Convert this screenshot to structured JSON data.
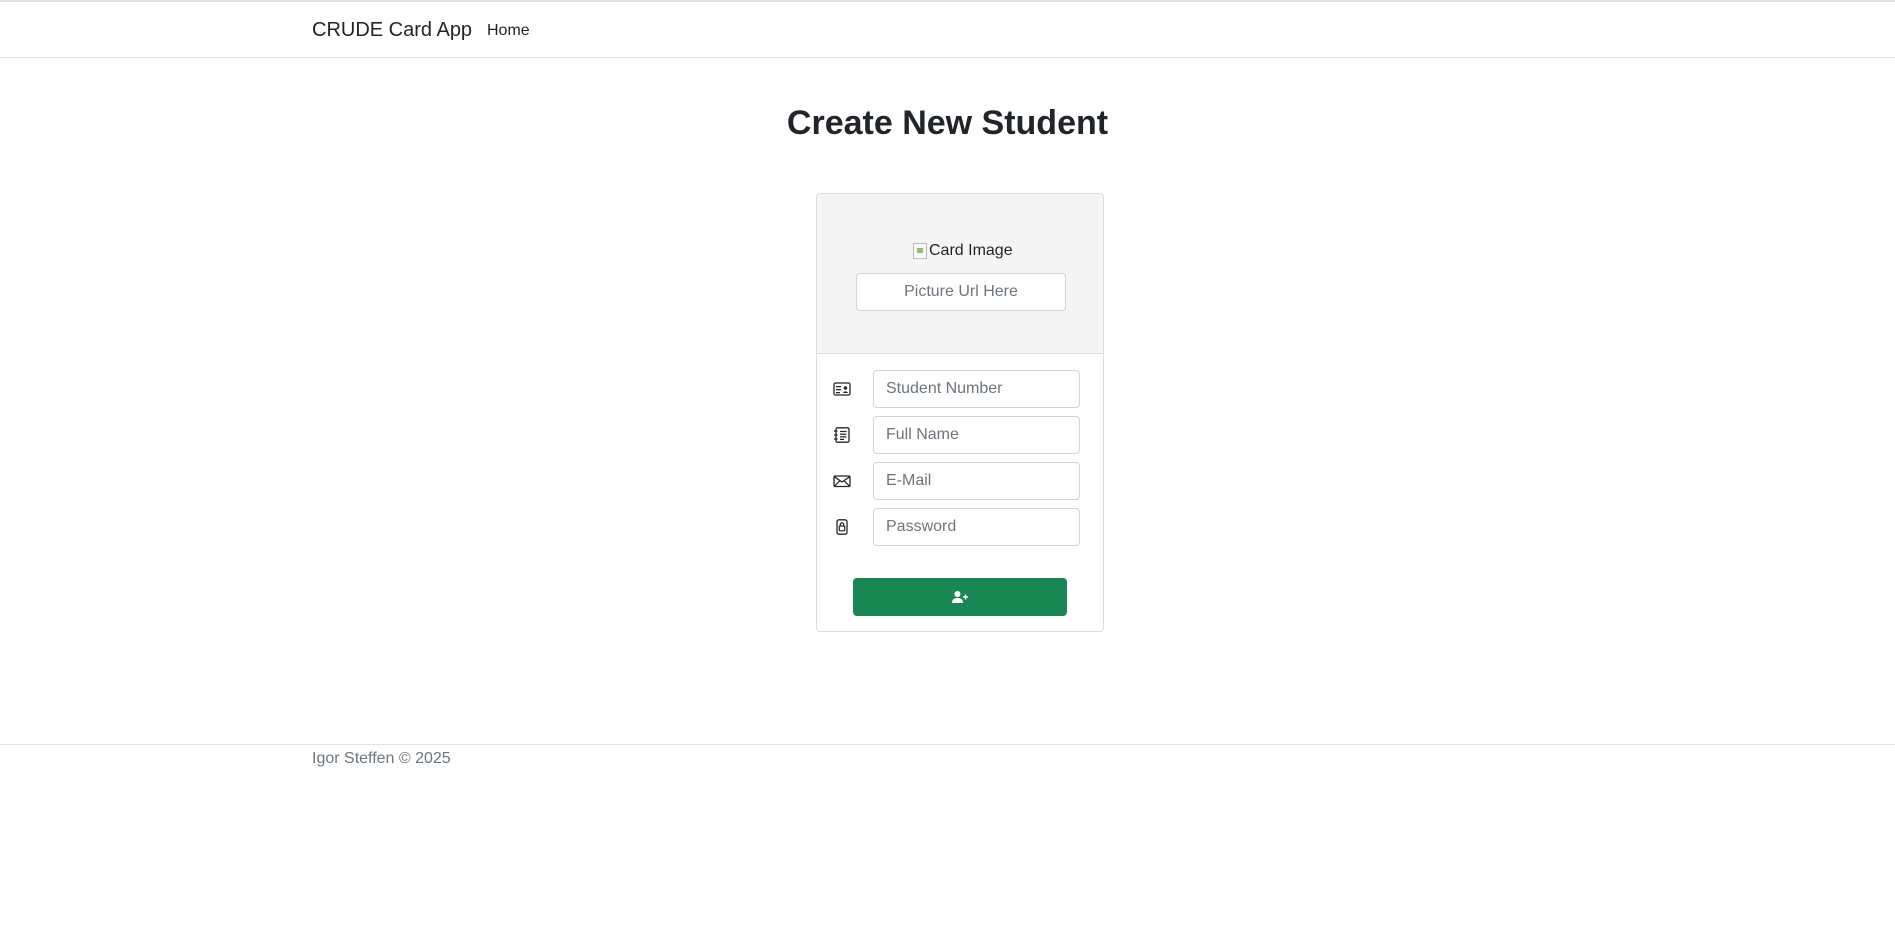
{
  "navbar": {
    "brand": "CRUDE Card App",
    "links": [
      {
        "label": "Home"
      }
    ]
  },
  "page": {
    "title": "Create New Student"
  },
  "card": {
    "image_alt": "Card Image",
    "picture_url": {
      "placeholder": "Picture Url Here",
      "value": ""
    },
    "fields": [
      {
        "icon": "id-card-icon",
        "placeholder": "Student Number",
        "value": ""
      },
      {
        "icon": "journal-text-icon",
        "placeholder": "Full Name",
        "value": ""
      },
      {
        "icon": "envelope-icon",
        "placeholder": "E-Mail",
        "value": ""
      },
      {
        "icon": "lock-icon",
        "placeholder": "Password",
        "value": ""
      }
    ],
    "submit": {
      "icon": "person-plus-icon",
      "color": "#198754"
    }
  },
  "footer": {
    "text": "Igor Steffen © 2025"
  }
}
